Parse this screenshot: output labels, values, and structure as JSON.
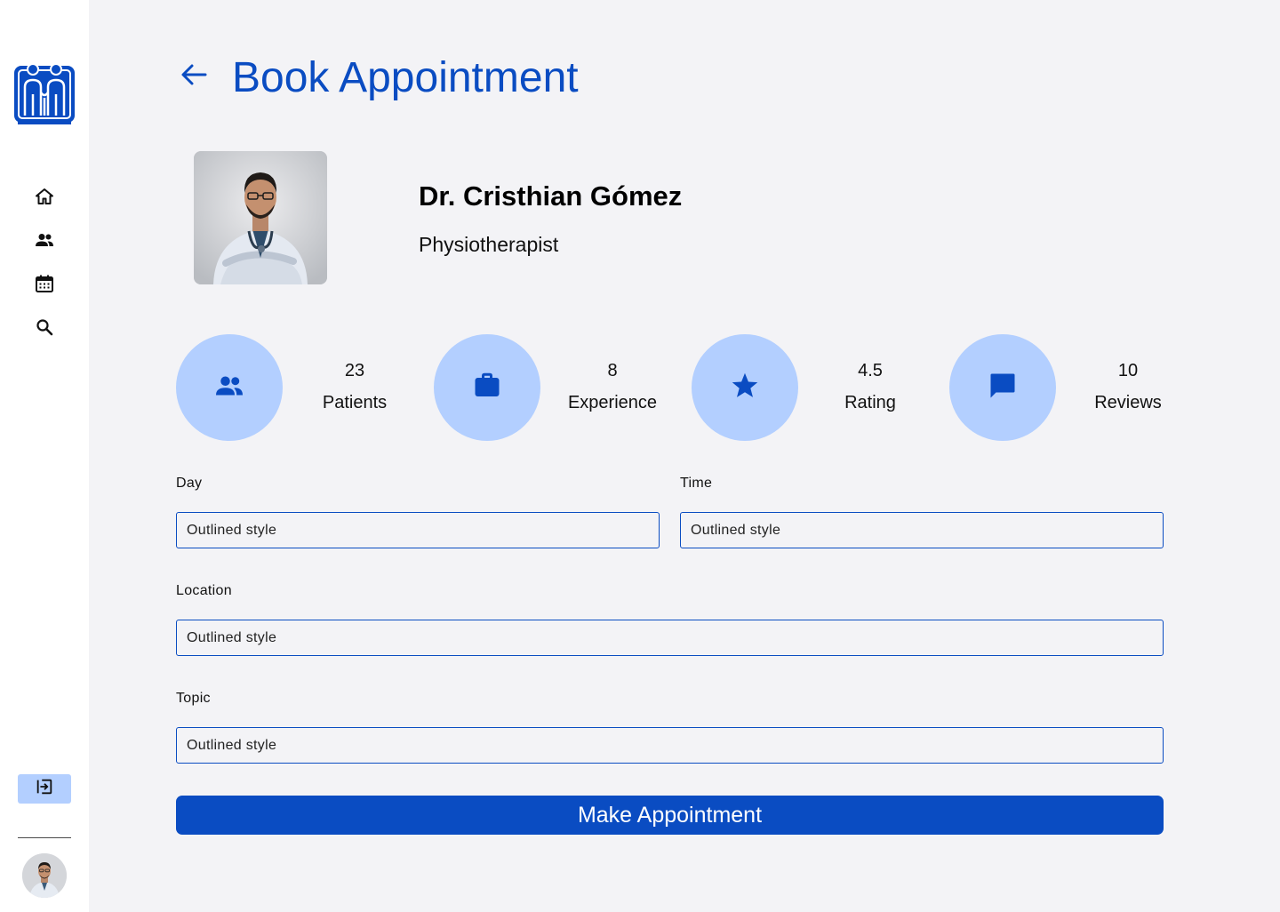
{
  "colors": {
    "primary": "#0a4cc2",
    "accent_light": "#b3cfff",
    "background": "#f3f3f6",
    "sidebar": "#ffffff"
  },
  "sidebar": {
    "logo_icon": "family-care-logo",
    "nav": [
      {
        "icon": "home-icon"
      },
      {
        "icon": "people-icon"
      },
      {
        "icon": "calendar-icon"
      },
      {
        "icon": "search-icon"
      }
    ],
    "logout_icon": "exit-icon",
    "avatar_icon": "user-avatar"
  },
  "header": {
    "back_icon": "arrow-left-icon",
    "title": "Book Appointment"
  },
  "doctor": {
    "name": "Dr. Cristhian Gómez",
    "specialty": "Physiotherapist"
  },
  "stats": [
    {
      "icon": "people-icon",
      "value": "23",
      "label": "Patients"
    },
    {
      "icon": "briefcase-icon",
      "value": "8",
      "label": "Experience"
    },
    {
      "icon": "star-icon",
      "value": "4.5",
      "label": "Rating"
    },
    {
      "icon": "chat-icon",
      "value": "10",
      "label": "Reviews"
    }
  ],
  "form": {
    "day": {
      "label": "Day",
      "placeholder": "Outlined style"
    },
    "time": {
      "label": "Time",
      "placeholder": "Outlined style"
    },
    "location": {
      "label": "Location",
      "placeholder": "Outlined style"
    },
    "topic": {
      "label": "Topic",
      "placeholder": "Outlined style"
    },
    "submit_label": "Make Appointment"
  }
}
